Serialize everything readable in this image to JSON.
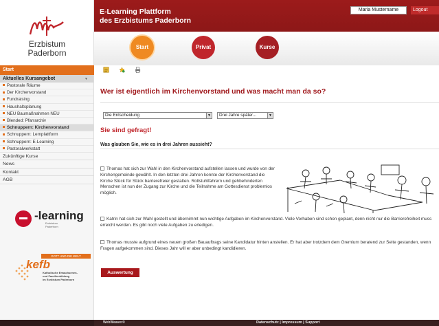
{
  "header": {
    "title_line1": "E-Learning Plattform",
    "title_line2": "des Erzbistums Paderborn",
    "user_name": "Maria Mustername",
    "logout_label": "Logout",
    "nav": [
      "Start",
      "Privat",
      "Kurse"
    ]
  },
  "logo": {
    "line1": "Erzbistum",
    "line2": "Paderborn"
  },
  "sidebar": {
    "start_label": "Start",
    "section_label": "Aktuelles Kursangebot",
    "items": [
      {
        "label": "Pastorale Räume"
      },
      {
        "label": "Der Kirchenvorstand"
      },
      {
        "label": "Fundraising"
      },
      {
        "label": "Haushaltsplanung"
      },
      {
        "label": "NEU Baumaßnahmen NEU"
      },
      {
        "label": "Blended: Pfarrarchiv"
      },
      {
        "label": "Schnuppern: Kirchenvorstand"
      },
      {
        "label": "Schnuppern: Lernplattform"
      },
      {
        "label": "Schnuppern: E-Learning"
      },
      {
        "label": "Pastoralwerkstatt"
      }
    ],
    "main_items": [
      "Zukünftige Kurse",
      "News",
      "Kontakt",
      "AGB"
    ]
  },
  "elearning_logo": {
    "word": "-learning",
    "sub1": "Erzbistum",
    "sub2": "Paderborn"
  },
  "kefb": {
    "tag": "GOTT UND DIE WELT",
    "word": "kefb",
    "sub1": "Katholische Erwachsenen-",
    "sub2": "und Familienbildung",
    "sub3": "im Erzbistum Paderborn"
  },
  "content": {
    "question_title": "Wer ist eigentlich im Kirchenvorstand und was macht man da so?",
    "select1_value": "Die Entscheidung",
    "select2_value": "Drei Jahre später...",
    "subtitle": "Sie sind gefragt!",
    "question": "Was glauben Sie, wie es in drei Jahren aussieht?",
    "option1": "Thomas hat sich zur Wahl in den Kirchenvorstand aufstellen lassen und wurde von der Kirchengemeinde gewählt. In den letzten drei Jahren konnte der Kirchenvorstand die Kirche Stück für Stück barrierefreier gestalten. Rollstuhlfahrern und gehbehinderten Menschen ist nun der Zugang zur Kirche und die Teilnahme am Gottesdienst problemlos möglich.",
    "option2": "Katrin hat sich zur Wahl gestellt und übernimmt nun wichtige Aufgaben im Kirchenvorstand. Viele Vorhaben sind schon geplant, denn nicht nur die Barrierefreiheit muss erreicht werden. Es gibt noch viele Aufgaben zu erledigen.",
    "option3": "Thomas musste aufgrund eines neuen großen Bauauftrags seine Kandidatur hinten anstellen. Er hat aber trotzdem dem Gremium beratend zur Seite gestanden, wenn Fragen aufgekommen sind. Dieses Jahr will er aber unbedingt kandidieren.",
    "submit_label": "Auswertung"
  },
  "footer": {
    "brand": "WebWeaver®",
    "links": "Datenschutz | Impressum | Support"
  },
  "colors": {
    "accent": "#e26f1c",
    "brand_red": "#a11b1f",
    "header": "#8a1a1a"
  }
}
